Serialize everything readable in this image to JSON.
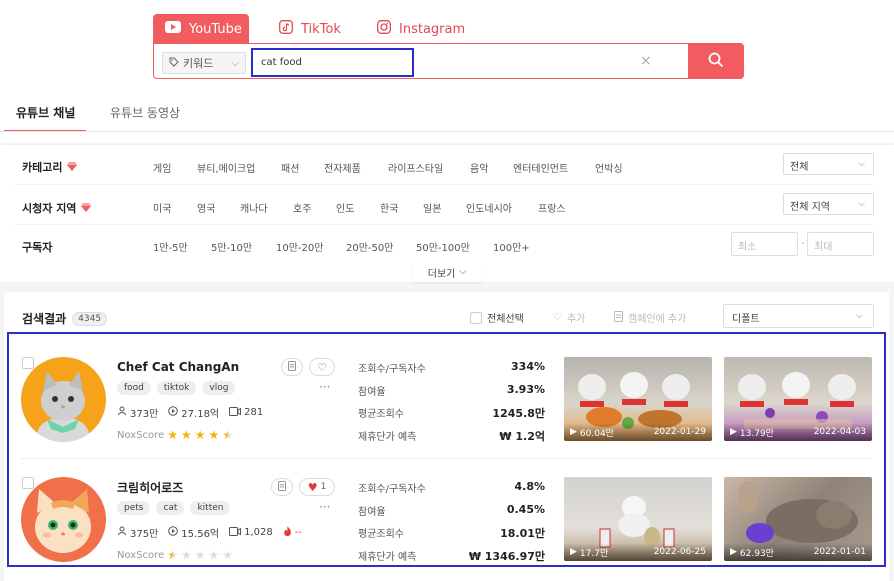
{
  "platforms": {
    "youtube": "YouTube",
    "tiktok": "TikTok",
    "instagram": "Instagram"
  },
  "search": {
    "keyword_type": "키워드",
    "query": "cat food"
  },
  "tabs": {
    "channel": "유튜브 채널",
    "video": "유튜브 동영상"
  },
  "filters": {
    "category": {
      "label": "카테고리",
      "items": [
        "게임",
        "뷰티,메이크업",
        "패션",
        "전자제품",
        "라이프스타일",
        "음악",
        "엔터테인먼트",
        "언박싱"
      ],
      "select": "전체"
    },
    "region": {
      "label": "시청자 지역",
      "items": [
        "미국",
        "영국",
        "캐나다",
        "호주",
        "인도",
        "한국",
        "일본",
        "인도네시아",
        "프랑스"
      ],
      "select": "전체 지역"
    },
    "subscribers": {
      "label": "구독자",
      "items": [
        "1만-5만",
        "5만-10만",
        "10만-20만",
        "20만-50만",
        "50만-100만",
        "100만+"
      ],
      "min_placeholder": "최소",
      "max_placeholder": "최대",
      "sep": "-"
    },
    "more": "더보기"
  },
  "results": {
    "title": "검색결과",
    "count": "4345",
    "select_all": "전체선택",
    "add": "추가",
    "add_campaign": "캠페인에 추가",
    "sort": "디폴트"
  },
  "metric_labels": [
    "조회수/구독자수",
    "참여율",
    "평균조회수",
    "제휴단가 예측"
  ],
  "channels": [
    {
      "name": "Chef Cat ChangAn",
      "tags": [
        "food",
        "tiktok",
        "vlog"
      ],
      "subscribers": "373만",
      "views": "27.18억",
      "videos": "281",
      "nox_label": "NoxScore",
      "nox_score": 4.5,
      "metrics": [
        "334%",
        "3.93%",
        "1245.8만",
        "₩ 1.2억"
      ],
      "thumbs": [
        {
          "views": "60.04만",
          "date": "2022-01-29"
        },
        {
          "views": "13.79만",
          "date": "2022-04-03"
        }
      ]
    },
    {
      "name": "크림히어로즈",
      "tags": [
        "pets",
        "cat",
        "kitten"
      ],
      "subscribers": "375만",
      "views": "15.56억",
      "videos": "1,028",
      "extra": "--",
      "likes": "1",
      "nox_label": "NoxScore",
      "nox_score": 1.5,
      "metrics": [
        "4.8%",
        "0.45%",
        "18.01만",
        "₩ 1346.97만"
      ],
      "thumbs": [
        {
          "views": "17.7만",
          "date": "2022-06-25"
        },
        {
          "views": "62.93만",
          "date": "2022-01-01"
        }
      ]
    }
  ],
  "colors": {
    "accent": "#f25b5f",
    "highlight": "#2d2dc8",
    "star": "#f5b400"
  },
  "icons": [
    "youtube-icon",
    "tiktok-icon",
    "instagram-icon",
    "tag-icon",
    "search-icon",
    "close-icon",
    "diamond-icon",
    "heart-icon",
    "document-icon",
    "play-icon"
  ]
}
